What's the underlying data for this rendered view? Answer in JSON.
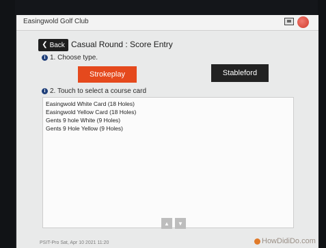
{
  "app": {
    "title": "Easingwold Golf Club"
  },
  "header": {
    "back_label": "Back",
    "page_title": "Casual Round : Score Entry"
  },
  "step1": {
    "label": "1. Choose type."
  },
  "types": {
    "strokeplay_label": "Strokeplay",
    "stableford_label": "Stableford"
  },
  "step2": {
    "label": "2. Touch to select a course card"
  },
  "course_cards": [
    "Easingwold White Card (18 Holes)",
    "Easingwold Yellow Card (18 Holes)",
    "Gents 9 hole White (9 Holes)",
    "Gents 9 Hole Yellow (9 Holes)"
  ],
  "footer": {
    "status": "PSIT-Pro    Sat, Apr 10 2021 11:20",
    "brand": "HowDidiDo.com"
  },
  "colors": {
    "accent": "#e5491d",
    "dark_button": "#222222"
  }
}
